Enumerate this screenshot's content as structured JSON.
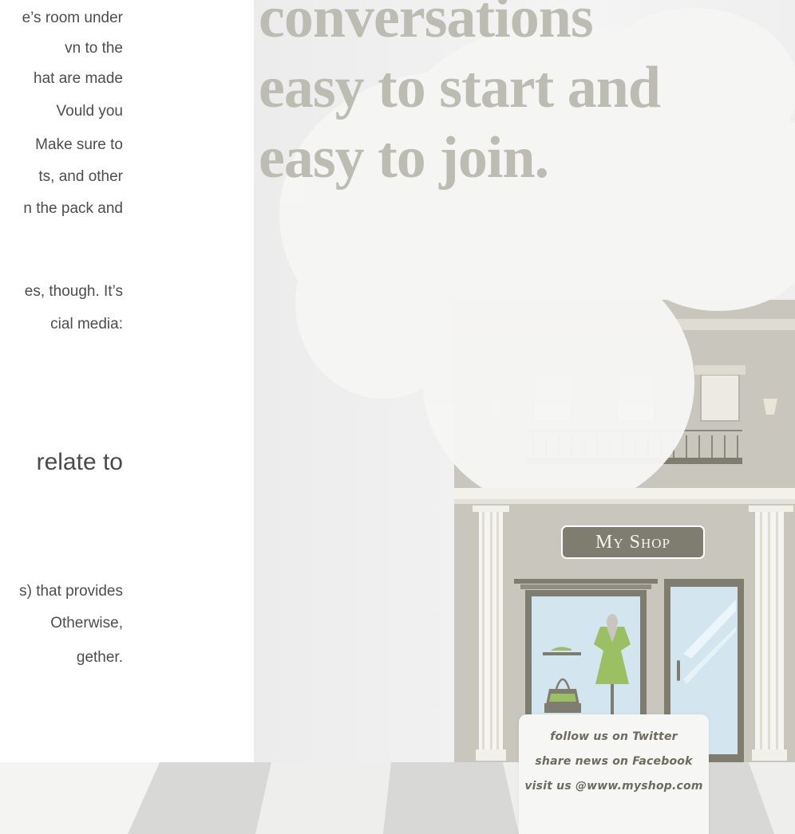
{
  "body_text": {
    "lines": [
      "e’s room under",
      "vn to the",
      "hat are made",
      "Vould you",
      "Make sure to",
      "ts, and other",
      "n the pack and",
      "es, though. It’s",
      "cial media:",
      "s) that provides",
      "Otherwise,",
      "gether."
    ],
    "heading": "relate to"
  },
  "headline": {
    "lines": [
      "conversations",
      "easy to start and",
      "easy to join."
    ]
  },
  "shop": {
    "sign": "My Shop"
  },
  "social_card": {
    "lines": [
      "follow us on Twitter",
      "share news on Facebook",
      "visit us @www.myshop.com"
    ]
  },
  "colors": {
    "headline": "#bcbcb2",
    "facade": "#c9c7bd",
    "trim": "#7f7d70",
    "window_glass": "#d3e6ef",
    "dress": "#9bbf63",
    "body_text": "#4d4d4d"
  }
}
